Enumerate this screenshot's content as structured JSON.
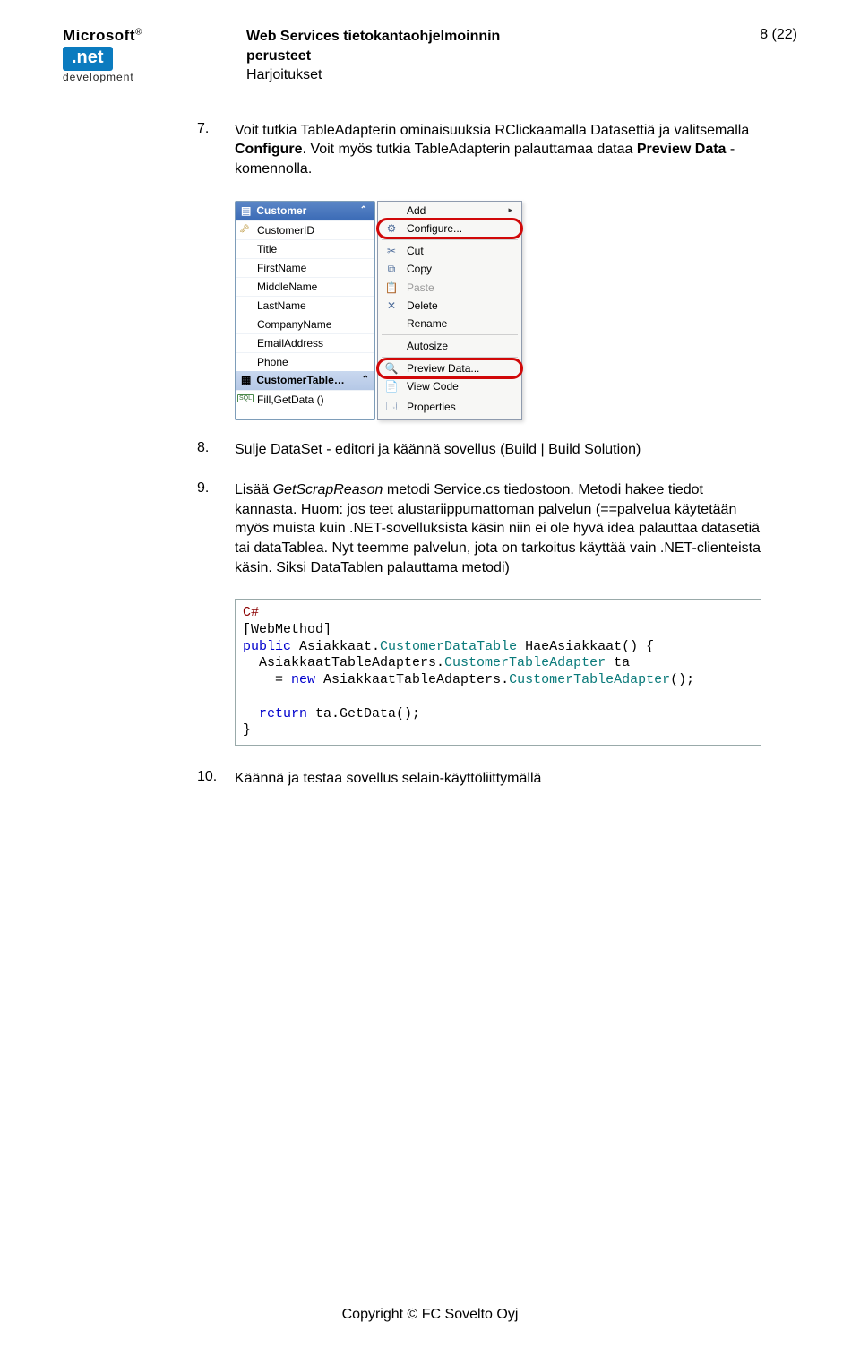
{
  "header": {
    "title_l1": "Web Services tietokantaohjelmoinnin",
    "title_l2": "perusteet",
    "title_l3": "Harjoitukset",
    "page_no": "8 (22)"
  },
  "logo": {
    "ms": "Microsoft",
    "net": ".net",
    "dev": "development"
  },
  "items": {
    "i7": {
      "num": "7.",
      "text_a": "Voit tutkia TableAdapterin ominaisuuksia RClickaamalla Datasettiä ja valitsemalla ",
      "bold_a": "Configure",
      "text_b": ". Voit myös tutkia TableAdapterin palauttamaa dataa ",
      "bold_b": "Preview Data",
      "text_c": " -komennolla."
    },
    "i8": {
      "num": "8.",
      "text": "Sulje DataSet - editori ja käännä sovellus (Build | Build Solution)"
    },
    "i9": {
      "num": "9.",
      "text_a": "Lisää ",
      "italic_a": "GetScrapReason",
      "text_b": " metodi Service.cs tiedostoon. Metodi hakee tiedot kannasta. Huom: jos teet alustariippumattoman palvelun (==palvelua käytetään myös muista kuin .NET-sovelluksista käsin niin ei ole hyvä idea palauttaa datasetiä tai dataTablea. Nyt teemme palvelun, jota on tarkoitus käyttää vain .NET-clienteista käsin. Siksi DataTablen palauttama metodi)"
    },
    "i10": {
      "num": "10.",
      "text": "Käännä ja testaa sovellus selain-käyttöliittymällä"
    }
  },
  "designer": {
    "table_header": "Customer",
    "cols": [
      "CustomerID",
      "Title",
      "FirstName",
      "MiddleName",
      "LastName",
      "CompanyName",
      "EmailAddress",
      "Phone"
    ],
    "adapter_header": "CustomerTable…",
    "fill": "Fill,GetData ()"
  },
  "menu": {
    "add": "Add",
    "configure": "Configure...",
    "cut": "Cut",
    "copy": "Copy",
    "paste": "Paste",
    "delete": "Delete",
    "rename": "Rename",
    "autosize": "Autosize",
    "preview": "Preview Data...",
    "viewcode": "View Code",
    "properties": "Properties"
  },
  "code": {
    "lang": "C#",
    "l1a": "[WebMethod]",
    "l2a": "public",
    "l2b": " Asiakkaat",
    "l2c": ".",
    "l2d": "CustomerDataTable",
    "l2e": " HaeAsiakkaat() {",
    "l3a": "  AsiakkaatTableAdapters.",
    "l3b": "CustomerTableAdapter",
    "l3c": " ta",
    "l4a": "    = ",
    "l4b": "new",
    "l4c": " AsiakkaatTableAdapters.",
    "l4d": "CustomerTableAdapter",
    "l4e": "();",
    "l5": "",
    "l6a": "  ",
    "l6b": "return",
    "l6c": " ta.GetData();",
    "l7": "}"
  },
  "footer": "Copyright © FC Sovelto Oyj"
}
